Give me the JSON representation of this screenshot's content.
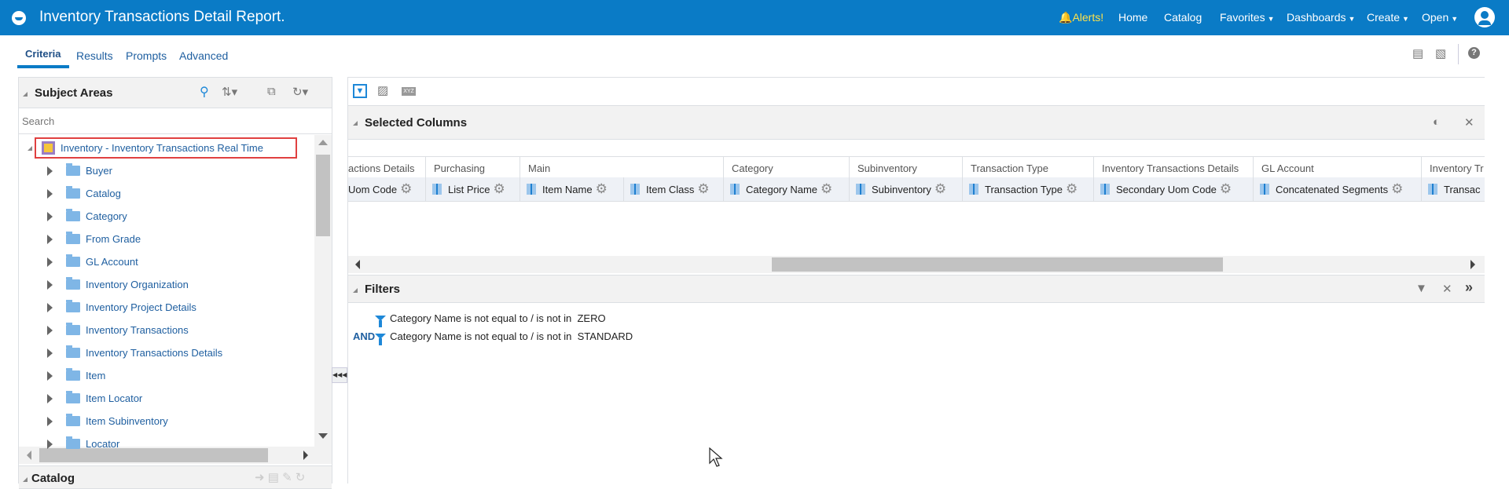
{
  "header": {
    "title": "Inventory Transactions Detail Report.",
    "alerts": "Alerts!",
    "nav": [
      "Home",
      "Catalog"
    ],
    "menus": [
      "Favorites",
      "Dashboards",
      "Create",
      "Open"
    ]
  },
  "tabs": [
    "Criteria",
    "Results",
    "Prompts",
    "Advanced"
  ],
  "subject_areas": {
    "title": "Subject Areas",
    "search_placeholder": "Search",
    "root": "Inventory - Inventory Transactions Real Time",
    "folders": [
      "Buyer",
      "Catalog",
      "Category",
      "From Grade",
      "GL Account",
      "Inventory Organization",
      "Inventory Project Details",
      "Inventory Transactions",
      "Inventory Transactions Details",
      "Item",
      "Item Locator",
      "Item Subinventory",
      "Locator"
    ]
  },
  "catalog": {
    "title": "Catalog"
  },
  "selected_columns": {
    "title": "Selected Columns",
    "groups": [
      "actions Details",
      "Purchasing",
      "Main",
      "Category",
      "Subinventory",
      "Transaction Type",
      "Inventory Transactions Details",
      "GL Account",
      "Inventory Tr"
    ],
    "columns": [
      "Uom Code",
      "List Price",
      "Item Name",
      "Item Class",
      "Category Name",
      "Subinventory",
      "Transaction Type",
      "Secondary Uom Code",
      "Concatenated Segments",
      "Transac"
    ]
  },
  "filters": {
    "title": "Filters",
    "and_label": "AND",
    "items": [
      "Category Name is not equal to / is not in  ZERO",
      "Category Name is not equal to / is not in  STANDARD"
    ]
  },
  "colors": {
    "header": "#0a7bc6",
    "link": "#1f5fa0",
    "highlight": "#e04040"
  }
}
